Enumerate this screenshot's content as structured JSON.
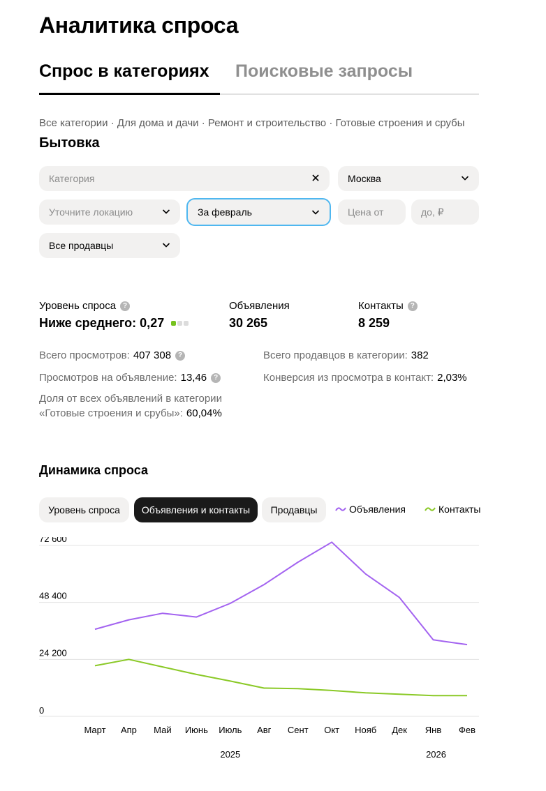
{
  "page": {
    "title": "Аналитика спроса"
  },
  "tabs": [
    {
      "label": "Спрос в категориях",
      "active": true
    },
    {
      "label": "Поисковые запросы",
      "active": false
    }
  ],
  "breadcrumb": [
    "Все категории",
    "Для дома и дачи",
    "Ремонт и строительство",
    "Готовые строения и срубы"
  ],
  "breadcrumb_sep": " · ",
  "subcategory": "Бытовка",
  "filters": {
    "category_placeholder": "Категория",
    "city": "Москва",
    "location_placeholder": "Уточните локацию",
    "period": "За февраль",
    "price_from_placeholder": "Цена от",
    "price_to_placeholder": "до, ₽",
    "sellers": "Все продавцы"
  },
  "metrics": {
    "demand_label": "Уровень спроса",
    "demand_value": "Ниже среднего: 0,27",
    "ads_label": "Объявления",
    "ads_value": "30 265",
    "contacts_label": "Контакты",
    "contacts_value": "8 259"
  },
  "stats": {
    "views_label": "Всего просмотров:",
    "views_value": "407 308",
    "views_per_ad_label": "Просмотров на объявление:",
    "views_per_ad_value": "13,46",
    "share_label_1": "Доля от всех объявлений в категории",
    "share_label_2": "«Готовые строения и срубы»:",
    "share_value": "60,04%",
    "sellers_label": "Всего продавцов в категории:",
    "sellers_value": "382",
    "conversion_label": "Конверсия из просмотра в контакт:",
    "conversion_value": "2,03%"
  },
  "dynamics": {
    "title": "Динамика спроса",
    "buttons": [
      {
        "label": "Уровень спроса",
        "active": false
      },
      {
        "label": "Объявления и контакты",
        "active": true
      },
      {
        "label": "Продавцы",
        "active": false
      }
    ],
    "legend": [
      {
        "label": "Объявления",
        "color": "#a363f0"
      },
      {
        "label": "Контакты",
        "color": "#8ac926"
      }
    ]
  },
  "colors": {
    "accent_focus": "#4fb7f0",
    "ads_line": "#a363f0",
    "contacts_line": "#8ac926",
    "level_on": "#76c21f"
  },
  "chart_data": {
    "type": "line",
    "categories": [
      "Март",
      "Апр",
      "Май",
      "Июнь",
      "Июль",
      "Авг",
      "Сент",
      "Окт",
      "Нояб",
      "Дек",
      "Янв",
      "Фев"
    ],
    "year_labels": [
      {
        "label": "2025",
        "at": "Июль"
      },
      {
        "label": "2026",
        "at": "Янв"
      }
    ],
    "series": [
      {
        "name": "Объявления",
        "values": [
          37000,
          41000,
          43800,
          42200,
          48000,
          56000,
          65500,
          74000,
          60500,
          50500,
          32500,
          30500
        ]
      },
      {
        "name": "Контакты",
        "values": [
          21500,
          24200,
          21000,
          17800,
          15000,
          12000,
          11800,
          11000,
          10000,
          9400,
          8800,
          8800
        ]
      }
    ],
    "yticks": [
      0,
      24200,
      48400,
      72600
    ],
    "ytick_labels": [
      "0",
      "24 200",
      "48 400",
      "72 600"
    ],
    "ylim": [
      0,
      72600
    ],
    "grid": true
  }
}
